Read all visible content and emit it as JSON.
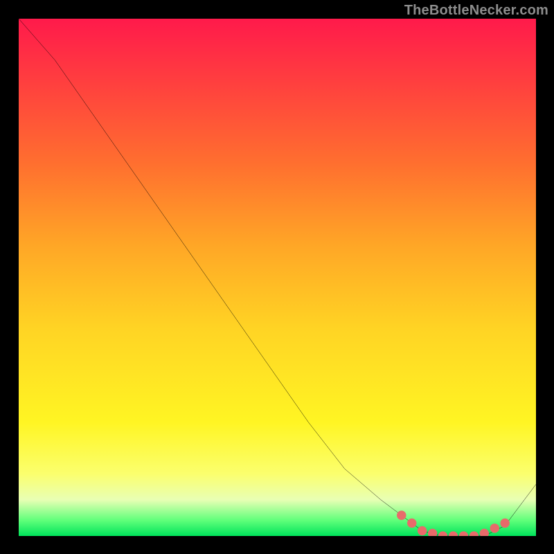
{
  "watermark": "TheBottleNecker.com",
  "chart_data": {
    "type": "line",
    "title": "",
    "xlabel": "",
    "ylabel": "",
    "xlim": [
      0,
      100
    ],
    "ylim": [
      0,
      100
    ],
    "grid": false,
    "legend": false,
    "background": "rainbow-vertical-gradient",
    "curve_color": "#000000",
    "marker_color": "#e86a6a",
    "series": [
      {
        "name": "curve",
        "x": [
          0,
          7,
          14,
          21,
          28,
          35,
          42,
          49,
          56,
          63,
          70,
          74,
          78,
          82,
          86,
          90,
          94,
          100
        ],
        "y": [
          100,
          92,
          82,
          72,
          62,
          52,
          42,
          32,
          22,
          13,
          7,
          4,
          1,
          0,
          0,
          0,
          2,
          10
        ]
      }
    ],
    "valley_markers_x": [
      74,
      76,
      78,
      80,
      82,
      84,
      86,
      88,
      90,
      92,
      94
    ],
    "valley_markers_y": [
      4,
      2.5,
      1,
      0.5,
      0,
      0,
      0,
      0,
      0.5,
      1.5,
      2.5
    ]
  }
}
